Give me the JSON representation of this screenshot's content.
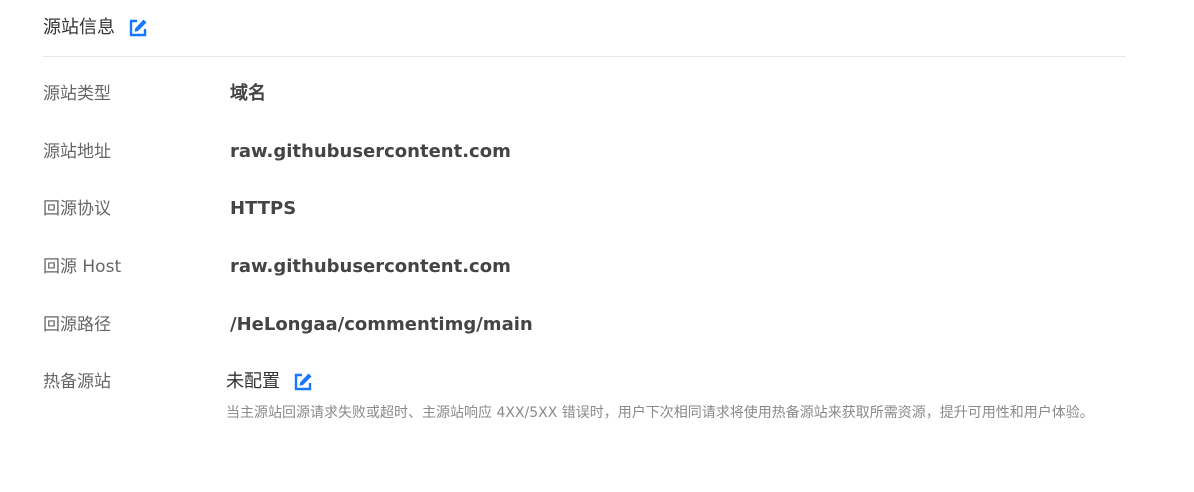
{
  "header": {
    "title": "源站信息",
    "edit_icon": "edit-icon"
  },
  "rows": {
    "origin_type": {
      "label": "源站类型",
      "value": "域名"
    },
    "origin_address": {
      "label": "源站地址",
      "value": "raw.githubusercontent.com"
    },
    "origin_protocol": {
      "label": "回源协议",
      "value": "HTTPS"
    },
    "origin_host": {
      "label": "回源 Host",
      "value": "raw.githubusercontent.com"
    },
    "origin_path": {
      "label": "回源路径",
      "value": "/HeLongaa/commentimg/main"
    },
    "hot_backup": {
      "label": "热备源站",
      "value": "未配置",
      "hint": "当主源站回源请求失败或超时、主源站响应 4XX/5XX 错误时，用户下次相同请求将使用热备源站来获取所需资源，提升可用性和用户体验。"
    }
  },
  "colors": {
    "accent": "#1677ff",
    "divider": "#e6e6e6",
    "label": "#666666",
    "hint": "#8a8a8a"
  }
}
